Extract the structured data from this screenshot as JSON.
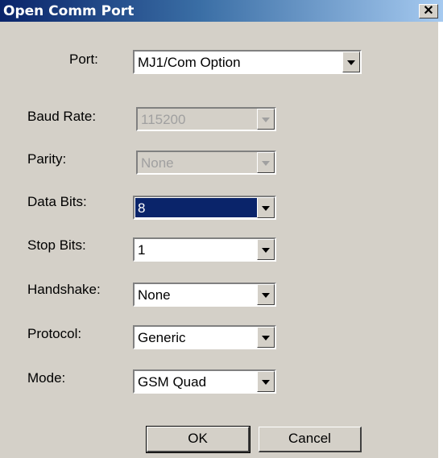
{
  "window": {
    "title": "Open Comm Port",
    "close_glyph": "✕"
  },
  "fields": {
    "port": {
      "label": "Port:",
      "value": "MJ1/Com Option"
    },
    "baud_rate": {
      "label": "Baud Rate:",
      "value": "115200"
    },
    "parity": {
      "label": "Parity:",
      "value": "None"
    },
    "data_bits": {
      "label": "Data Bits:",
      "value": "8"
    },
    "stop_bits": {
      "label": "Stop Bits:",
      "value": "1"
    },
    "handshake": {
      "label": "Handshake:",
      "value": "None"
    },
    "protocol": {
      "label": "Protocol:",
      "value": "Generic"
    },
    "mode": {
      "label": "Mode:",
      "value": "GSM Quad"
    }
  },
  "buttons": {
    "ok": "OK",
    "cancel": "Cancel"
  }
}
